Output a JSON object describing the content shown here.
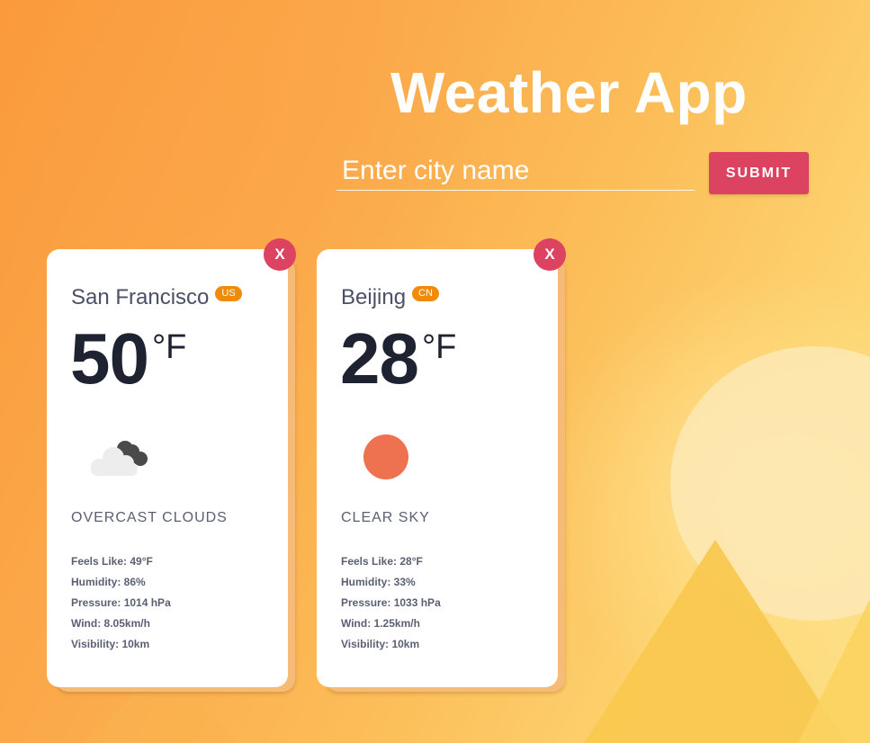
{
  "app": {
    "title": "Weather App"
  },
  "search": {
    "placeholder": "Enter city name",
    "value": "",
    "submit_label": "SUBMIT"
  },
  "cards": [
    {
      "close_label": "X",
      "city": "San Francisco",
      "country": "US",
      "temperature": "50",
      "unit": "°F",
      "icon": "overcast-clouds-icon",
      "description": "OVERCAST CLOUDS",
      "details": [
        "Feels Like: 49°F",
        "Humidity: 86%",
        "Pressure: 1014 hPa",
        "Wind: 8.05km/h",
        "Visibility: 10km"
      ]
    },
    {
      "close_label": "X",
      "city": "Beijing",
      "country": "CN",
      "temperature": "28",
      "unit": "°F",
      "icon": "clear-sky-sun-icon",
      "description": "CLEAR SKY",
      "details": [
        "Feels Like: 28°F",
        "Humidity: 33%",
        "Pressure: 1033 hPa",
        "Wind: 1.25km/h",
        "Visibility: 10km"
      ]
    }
  ],
  "colors": {
    "accent": "#dc4360",
    "badge": "#ef8b07",
    "sun": "#ee7150",
    "text_dark": "#1e2231",
    "text_muted": "#5a5f74"
  }
}
